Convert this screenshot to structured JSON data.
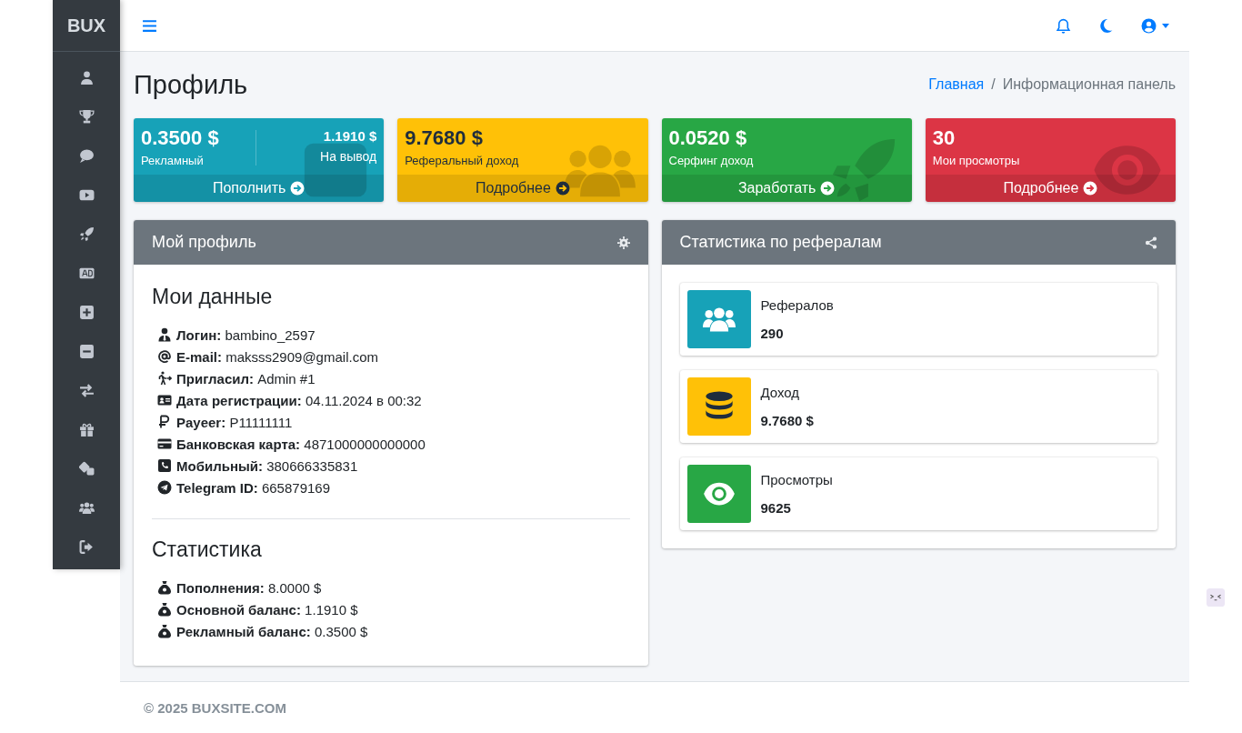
{
  "sidebar": {
    "brand": "BUX"
  },
  "page": {
    "title": "Профиль",
    "separator": "/",
    "breadcrumb": [
      {
        "label": "Главная",
        "kind": "link"
      },
      {
        "label": "Информационная панель",
        "kind": "current"
      }
    ]
  },
  "info_boxes": [
    {
      "value": "0.3500 $",
      "label": "Рекламный",
      "secondary": {
        "value": "1.1910 $",
        "label": "На вывод"
      },
      "footer": "Пополнить",
      "color": "#17a2b8"
    },
    {
      "value": "9.7680 $",
      "label": "Реферальный доход",
      "footer": "Подробнее",
      "color": "#ffc107"
    },
    {
      "value": "0.0520 $",
      "label": "Серфинг доход",
      "footer": "Заработать",
      "color": "#28a745"
    },
    {
      "value": "30",
      "label": "Мои просмотры",
      "footer": "Подробнее",
      "color": "#dc3545"
    }
  ],
  "profile_card": {
    "title": "Мой профиль",
    "sections": [
      {
        "heading": "Мои данные",
        "items": [
          {
            "label": "Логин:",
            "value": "bambino_2597"
          },
          {
            "label": "E-mail:",
            "value": "maksss2909@gmail.com"
          },
          {
            "label": "Пригласил:",
            "value": "Admin #1"
          },
          {
            "label": "Дата регистрации:",
            "value": "04.11.2024 в 00:32"
          },
          {
            "label": "Payeer:",
            "value": "P11111111"
          },
          {
            "label": "Банковская карта:",
            "value": "4871000000000000"
          },
          {
            "label": "Мобильный:",
            "value": "380666335831"
          },
          {
            "label": "Telegram ID:",
            "value": "665879169"
          }
        ]
      },
      {
        "heading": "Статистика",
        "items": [
          {
            "label": "Пополнения:",
            "value": "8.0000 $"
          },
          {
            "label": "Основной баланс:",
            "value": "1.1910 $"
          },
          {
            "label": "Рекламный баланс:",
            "value": "0.3500 $"
          }
        ]
      }
    ]
  },
  "referral_card": {
    "title": "Статистика по рефералам",
    "items": [
      {
        "label": "Рефералов",
        "value": "290",
        "color": "#17a2b8"
      },
      {
        "label": "Доход",
        "value": "9.7680 $",
        "color": "#ffc107"
      },
      {
        "label": "Просмотры",
        "value": "9625",
        "color": "#28a745"
      }
    ]
  },
  "footer": {
    "text": "© 2025 BUXSITE.COM"
  }
}
